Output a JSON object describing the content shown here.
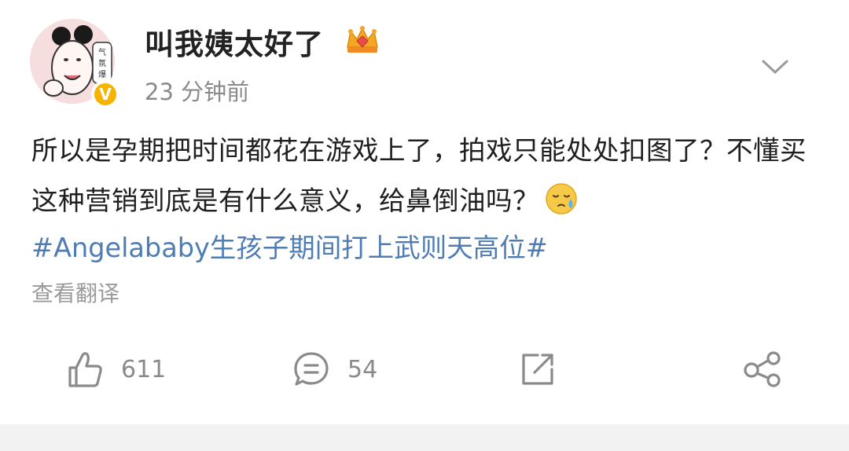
{
  "post": {
    "username": "叫我姨太好了",
    "avatar_text": "气氛爆",
    "verified_badge": "V",
    "time": "23 分钟前",
    "text": "所以是孕期把时间都花在游戏上了，拍戏只能处处扣图了？不懂买这种营销到底是有什么意义，给鼻倒油吗？",
    "hashtag": "#Angelababy生孩子期间打上武则天高位#",
    "translate_label": "查看翻译"
  },
  "actions": {
    "like_count": "611",
    "comment_count": "54"
  },
  "icons": {
    "crown": "crown-icon",
    "chevron": "chevron-down-icon",
    "emoji": "sweat-emoji-icon",
    "like": "thumbs-up-icon",
    "comment": "comment-icon",
    "repost": "repost-icon",
    "share": "share-icon"
  },
  "colors": {
    "hashtag": "#4f7db3",
    "verified": "#f4b400",
    "muted": "#8a8a8a"
  }
}
